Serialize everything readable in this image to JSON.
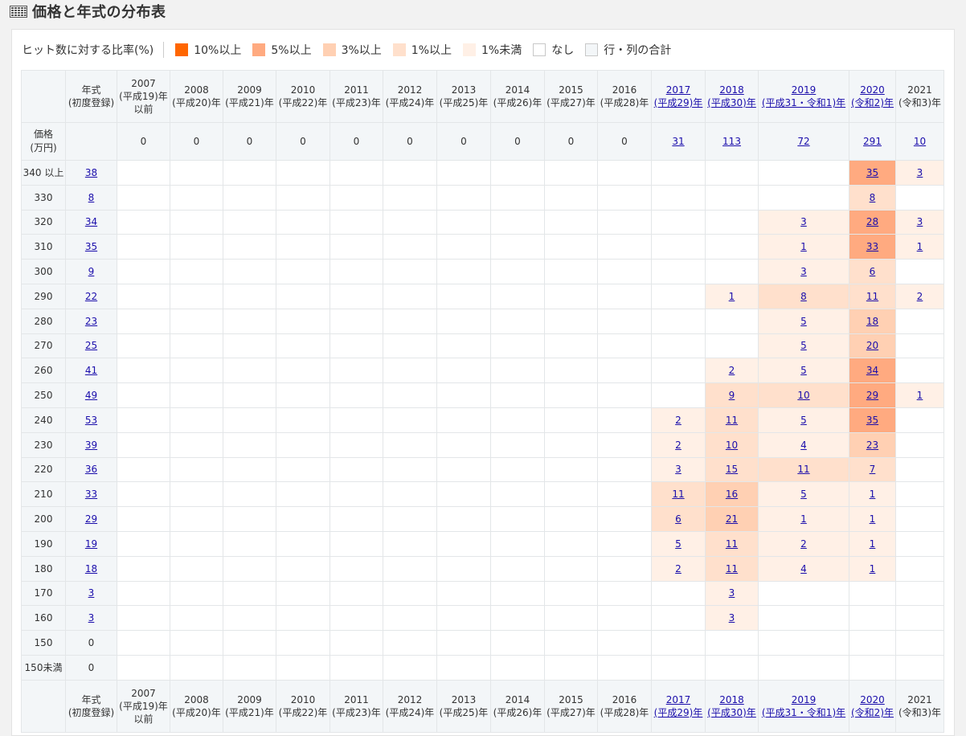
{
  "page": {
    "title": "価格と年式の分布表"
  },
  "legend": {
    "caption": "ヒット数に対する比率(%)",
    "items": [
      {
        "label": "10%以上",
        "color": "#ff6600"
      },
      {
        "label": "5%以上",
        "color": "#ffaa80"
      },
      {
        "label": "3%以上",
        "color": "#ffd0b3"
      },
      {
        "label": "1%以上",
        "color": "#ffe0cc"
      },
      {
        "label": "1%未満",
        "color": "#fff0e6"
      },
      {
        "label": "なし",
        "color": "#ffffff"
      },
      {
        "label": "行・列の合計",
        "color": "#f3f6f8"
      }
    ]
  },
  "table": {
    "year_header": {
      "line1": "年式",
      "line2": "(初度登録)"
    },
    "price_header": {
      "line1": "価格",
      "line2": "(万円)"
    },
    "years": [
      {
        "lines": [
          "2007",
          "(平成19)年",
          "以前"
        ],
        "link": false
      },
      {
        "lines": [
          "2008",
          "(平成20)年"
        ],
        "link": false
      },
      {
        "lines": [
          "2009",
          "(平成21)年"
        ],
        "link": false
      },
      {
        "lines": [
          "2010",
          "(平成22)年"
        ],
        "link": false
      },
      {
        "lines": [
          "2011",
          "(平成23)年"
        ],
        "link": false
      },
      {
        "lines": [
          "2012",
          "(平成24)年"
        ],
        "link": false
      },
      {
        "lines": [
          "2013",
          "(平成25)年"
        ],
        "link": false
      },
      {
        "lines": [
          "2014",
          "(平成26)年"
        ],
        "link": false
      },
      {
        "lines": [
          "2015",
          "(平成27)年"
        ],
        "link": false
      },
      {
        "lines": [
          "2016",
          "(平成28)年"
        ],
        "link": false
      },
      {
        "lines": [
          "2017",
          "(平成29)年"
        ],
        "link": true
      },
      {
        "lines": [
          "2018",
          "(平成30)年"
        ],
        "link": true
      },
      {
        "lines": [
          "2019",
          "(平成31・令和1)年"
        ],
        "link": true
      },
      {
        "lines": [
          "2020",
          "(令和2)年"
        ],
        "link": true
      },
      {
        "lines": [
          "2021",
          "(令和3)年"
        ],
        "link": false
      }
    ],
    "year_totals": [
      "0",
      "0",
      "0",
      "0",
      "0",
      "0",
      "0",
      "0",
      "0",
      "0",
      "31",
      "113",
      "72",
      "291",
      "10"
    ],
    "rows": [
      {
        "price": "340 以上",
        "total": "38",
        "cells": [
          "",
          "",
          "",
          "",
          "",
          "",
          "",
          "",
          "",
          "",
          "",
          "",
          "",
          "35",
          "3"
        ],
        "shade": [
          "",
          "",
          "",
          "",
          "",
          "",
          "",
          "",
          "",
          "",
          "",
          "",
          "",
          "l2",
          "l5"
        ]
      },
      {
        "price": "330",
        "total": "8",
        "cells": [
          "",
          "",
          "",
          "",
          "",
          "",
          "",
          "",
          "",
          "",
          "",
          "",
          "",
          "8",
          ""
        ],
        "shade": [
          "",
          "",
          "",
          "",
          "",
          "",
          "",
          "",
          "",
          "",
          "",
          "",
          "",
          "l4",
          ""
        ]
      },
      {
        "price": "320",
        "total": "34",
        "cells": [
          "",
          "",
          "",
          "",
          "",
          "",
          "",
          "",
          "",
          "",
          "",
          "",
          "3",
          "28",
          "3"
        ],
        "shade": [
          "",
          "",
          "",
          "",
          "",
          "",
          "",
          "",
          "",
          "",
          "",
          "",
          "l5",
          "l2",
          "l5"
        ]
      },
      {
        "price": "310",
        "total": "35",
        "cells": [
          "",
          "",
          "",
          "",
          "",
          "",
          "",
          "",
          "",
          "",
          "",
          "",
          "1",
          "33",
          "1"
        ],
        "shade": [
          "",
          "",
          "",
          "",
          "",
          "",
          "",
          "",
          "",
          "",
          "",
          "",
          "l5",
          "l2",
          "l5"
        ]
      },
      {
        "price": "300",
        "total": "9",
        "cells": [
          "",
          "",
          "",
          "",
          "",
          "",
          "",
          "",
          "",
          "",
          "",
          "",
          "3",
          "6",
          ""
        ],
        "shade": [
          "",
          "",
          "",
          "",
          "",
          "",
          "",
          "",
          "",
          "",
          "",
          "",
          "l5",
          "l4",
          ""
        ]
      },
      {
        "price": "290",
        "total": "22",
        "cells": [
          "",
          "",
          "",
          "",
          "",
          "",
          "",
          "",
          "",
          "",
          "",
          "1",
          "8",
          "11",
          "2"
        ],
        "shade": [
          "",
          "",
          "",
          "",
          "",
          "",
          "",
          "",
          "",
          "",
          "",
          "l5",
          "l4",
          "l4",
          "l5"
        ]
      },
      {
        "price": "280",
        "total": "23",
        "cells": [
          "",
          "",
          "",
          "",
          "",
          "",
          "",
          "",
          "",
          "",
          "",
          "",
          "5",
          "18",
          ""
        ],
        "shade": [
          "",
          "",
          "",
          "",
          "",
          "",
          "",
          "",
          "",
          "",
          "",
          "",
          "l5",
          "l3",
          ""
        ]
      },
      {
        "price": "270",
        "total": "25",
        "cells": [
          "",
          "",
          "",
          "",
          "",
          "",
          "",
          "",
          "",
          "",
          "",
          "",
          "5",
          "20",
          ""
        ],
        "shade": [
          "",
          "",
          "",
          "",
          "",
          "",
          "",
          "",
          "",
          "",
          "",
          "",
          "l5",
          "l3",
          ""
        ]
      },
      {
        "price": "260",
        "total": "41",
        "cells": [
          "",
          "",
          "",
          "",
          "",
          "",
          "",
          "",
          "",
          "",
          "",
          "2",
          "5",
          "34",
          ""
        ],
        "shade": [
          "",
          "",
          "",
          "",
          "",
          "",
          "",
          "",
          "",
          "",
          "",
          "l5",
          "l5",
          "l2",
          ""
        ]
      },
      {
        "price": "250",
        "total": "49",
        "cells": [
          "",
          "",
          "",
          "",
          "",
          "",
          "",
          "",
          "",
          "",
          "",
          "9",
          "10",
          "29",
          "1"
        ],
        "shade": [
          "",
          "",
          "",
          "",
          "",
          "",
          "",
          "",
          "",
          "",
          "",
          "l4",
          "l4",
          "l2",
          "l5"
        ]
      },
      {
        "price": "240",
        "total": "53",
        "cells": [
          "",
          "",
          "",
          "",
          "",
          "",
          "",
          "",
          "",
          "",
          "2",
          "11",
          "5",
          "35",
          ""
        ],
        "shade": [
          "",
          "",
          "",
          "",
          "",
          "",
          "",
          "",
          "",
          "",
          "l5",
          "l4",
          "l5",
          "l2",
          ""
        ]
      },
      {
        "price": "230",
        "total": "39",
        "cells": [
          "",
          "",
          "",
          "",
          "",
          "",
          "",
          "",
          "",
          "",
          "2",
          "10",
          "4",
          "23",
          ""
        ],
        "shade": [
          "",
          "",
          "",
          "",
          "",
          "",
          "",
          "",
          "",
          "",
          "l5",
          "l4",
          "l5",
          "l3",
          ""
        ]
      },
      {
        "price": "220",
        "total": "36",
        "cells": [
          "",
          "",
          "",
          "",
          "",
          "",
          "",
          "",
          "",
          "",
          "3",
          "15",
          "11",
          "7",
          ""
        ],
        "shade": [
          "",
          "",
          "",
          "",
          "",
          "",
          "",
          "",
          "",
          "",
          "l5",
          "l4",
          "l4",
          "l4",
          ""
        ]
      },
      {
        "price": "210",
        "total": "33",
        "cells": [
          "",
          "",
          "",
          "",
          "",
          "",
          "",
          "",
          "",
          "",
          "11",
          "16",
          "5",
          "1",
          ""
        ],
        "shade": [
          "",
          "",
          "",
          "",
          "",
          "",
          "",
          "",
          "",
          "",
          "l4",
          "l3",
          "l5",
          "l5",
          ""
        ]
      },
      {
        "price": "200",
        "total": "29",
        "cells": [
          "",
          "",
          "",
          "",
          "",
          "",
          "",
          "",
          "",
          "",
          "6",
          "21",
          "1",
          "1",
          ""
        ],
        "shade": [
          "",
          "",
          "",
          "",
          "",
          "",
          "",
          "",
          "",
          "",
          "l4",
          "l3",
          "l5",
          "l5",
          ""
        ]
      },
      {
        "price": "190",
        "total": "19",
        "cells": [
          "",
          "",
          "",
          "",
          "",
          "",
          "",
          "",
          "",
          "",
          "5",
          "11",
          "2",
          "1",
          ""
        ],
        "shade": [
          "",
          "",
          "",
          "",
          "",
          "",
          "",
          "",
          "",
          "",
          "l5",
          "l4",
          "l5",
          "l5",
          ""
        ]
      },
      {
        "price": "180",
        "total": "18",
        "cells": [
          "",
          "",
          "",
          "",
          "",
          "",
          "",
          "",
          "",
          "",
          "2",
          "11",
          "4",
          "1",
          ""
        ],
        "shade": [
          "",
          "",
          "",
          "",
          "",
          "",
          "",
          "",
          "",
          "",
          "l5",
          "l4",
          "l5",
          "l5",
          ""
        ]
      },
      {
        "price": "170",
        "total": "3",
        "cells": [
          "",
          "",
          "",
          "",
          "",
          "",
          "",
          "",
          "",
          "",
          "",
          "3",
          "",
          "",
          ""
        ],
        "shade": [
          "",
          "",
          "",
          "",
          "",
          "",
          "",
          "",
          "",
          "",
          "",
          "l5",
          "",
          "",
          ""
        ]
      },
      {
        "price": "160",
        "total": "3",
        "cells": [
          "",
          "",
          "",
          "",
          "",
          "",
          "",
          "",
          "",
          "",
          "",
          "3",
          "",
          "",
          ""
        ],
        "shade": [
          "",
          "",
          "",
          "",
          "",
          "",
          "",
          "",
          "",
          "",
          "",
          "l5",
          "",
          "",
          ""
        ]
      },
      {
        "price": "150",
        "total": "0",
        "cells": [
          "",
          "",
          "",
          "",
          "",
          "",
          "",
          "",
          "",
          "",
          "",
          "",
          "",
          "",
          ""
        ],
        "shade": [
          "",
          "",
          "",
          "",
          "",
          "",
          "",
          "",
          "",
          "",
          "",
          "",
          "",
          "",
          ""
        ]
      },
      {
        "price": "150未満",
        "total": "0",
        "cells": [
          "",
          "",
          "",
          "",
          "",
          "",
          "",
          "",
          "",
          "",
          "",
          "",
          "",
          "",
          ""
        ],
        "shade": [
          "",
          "",
          "",
          "",
          "",
          "",
          "",
          "",
          "",
          "",
          "",
          "",
          "",
          "",
          ""
        ]
      }
    ],
    "shade_colors": {
      "l1": "#ff6600",
      "l2": "#ffaa80",
      "l3": "#ffd0b3",
      "l4": "#ffe0cc",
      "l5": "#fff0e6"
    }
  }
}
